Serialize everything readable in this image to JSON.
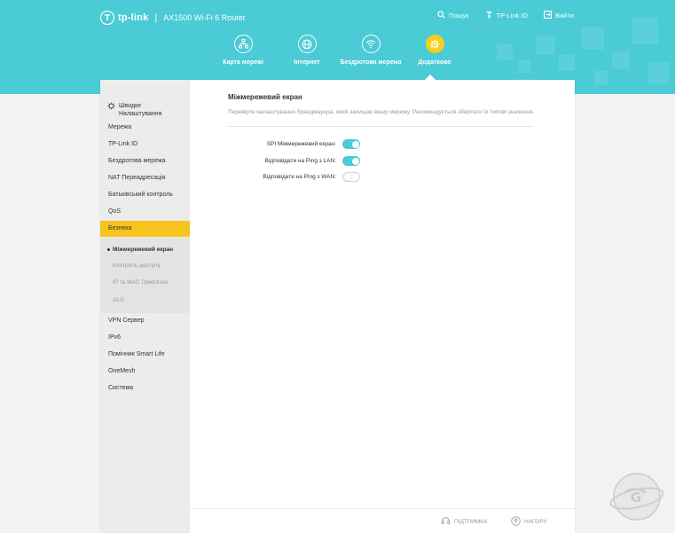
{
  "header": {
    "brand": "tp-link",
    "model": "AX1500 Wi-Fi 6 Router",
    "links": [
      {
        "label": "Пошук",
        "icon": "search-icon"
      },
      {
        "label": "TP-Link ID",
        "icon": "user-icon"
      },
      {
        "label": "Вийти",
        "icon": "logout-icon"
      }
    ]
  },
  "main_nav": [
    {
      "label": "Карта мережі",
      "icon": "network-map-icon",
      "active": false
    },
    {
      "label": "Інтернет",
      "icon": "globe-icon",
      "active": false
    },
    {
      "label": "Бездротова мережа",
      "icon": "wifi-icon",
      "active": false
    },
    {
      "label": "Додатково",
      "icon": "gear-icon",
      "active": true
    }
  ],
  "sidebar": {
    "quick_setup": "Швидке Налаштування",
    "items": [
      {
        "label": "Мережа"
      },
      {
        "label": "TP-Link ID"
      },
      {
        "label": "Бездротова мережа"
      },
      {
        "label": "NAT Переадресація"
      },
      {
        "label": "Батьківський контроль"
      },
      {
        "label": "QoS"
      },
      {
        "label": "Безпека",
        "active": true
      },
      {
        "label": "VPN Сервер"
      },
      {
        "label": "IPv6"
      },
      {
        "label": "Помічник Smart Life"
      },
      {
        "label": "OneMesh"
      },
      {
        "label": "Система"
      }
    ],
    "subitems": [
      {
        "label": "Міжмережевий екран",
        "active": true
      },
      {
        "label": "Контроль доступу"
      },
      {
        "label": "IP та MAC Прив'язка"
      },
      {
        "label": "ALG"
      }
    ]
  },
  "content": {
    "title": "Міжмережевий екран",
    "description": "Перевірте налаштування брандмауера, який захищає вашу мережу. Рекомендується зберігати їх типові значення.",
    "settings": [
      {
        "label": "SPI Міжмережевий екран:",
        "enabled": true
      },
      {
        "label": "Відповідати на Ping з LAN:",
        "enabled": true
      },
      {
        "label": "Відповідати на Ping з WAN:",
        "enabled": false
      }
    ]
  },
  "footer": {
    "support": "ПІДТРИМКА",
    "top": "НАГОРУ"
  },
  "colors": {
    "accent": "#4acbd6",
    "active": "#f7c41b"
  }
}
